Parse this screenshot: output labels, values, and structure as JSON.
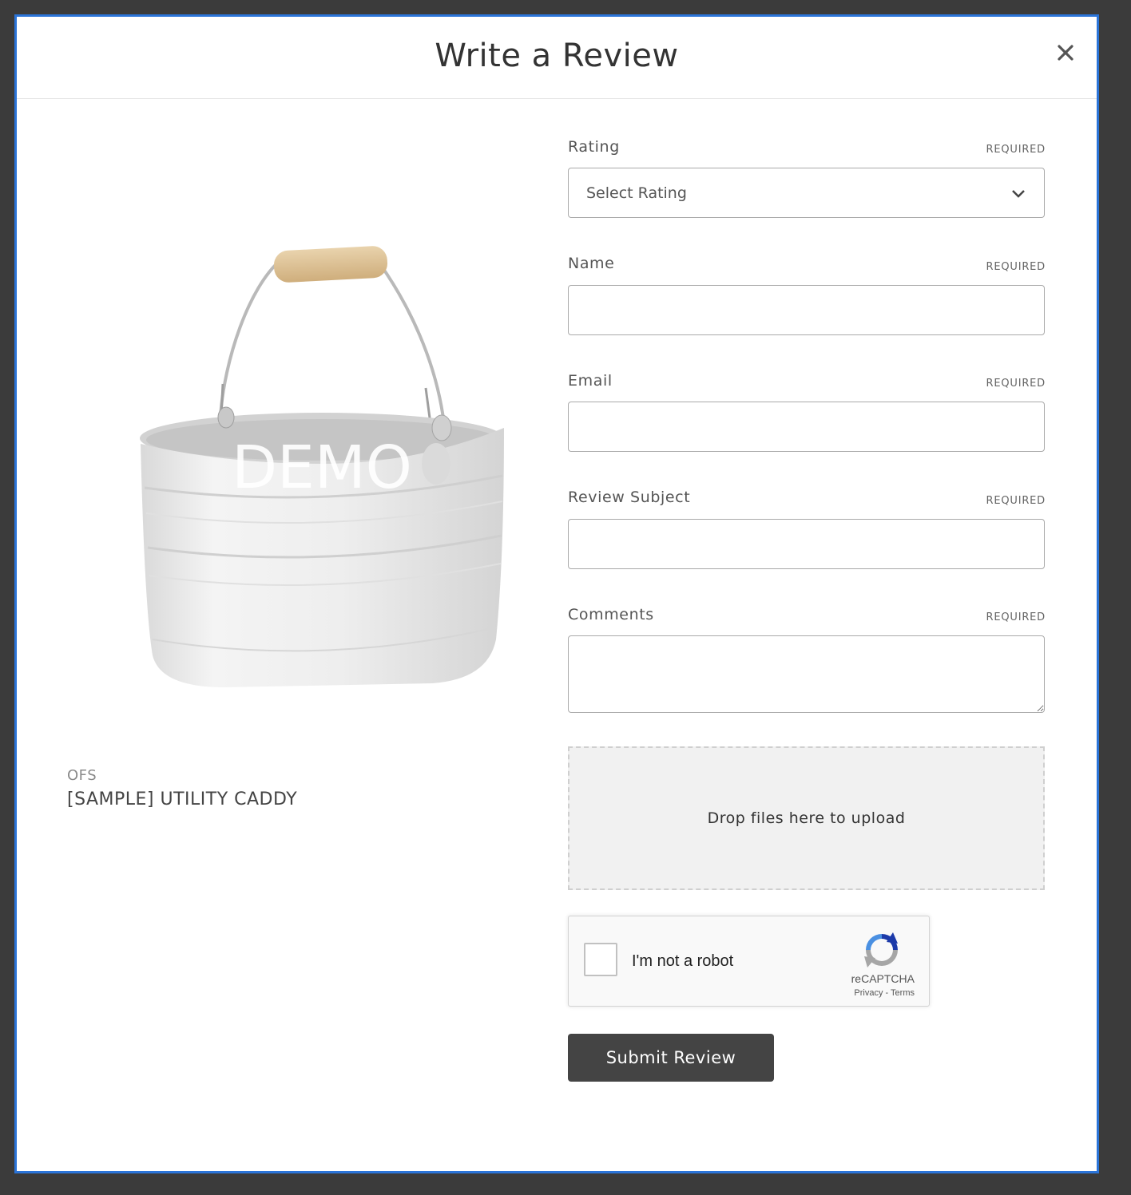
{
  "modal": {
    "title": "Write a Review",
    "close_label": "×"
  },
  "product": {
    "watermark": "DEMO",
    "brand": "OFS",
    "name": "[SAMPLE] UTILITY CADDY"
  },
  "form": {
    "required_text": "REQUIRED",
    "rating": {
      "label": "Rating",
      "selected": "Select Rating"
    },
    "name": {
      "label": "Name",
      "value": ""
    },
    "email": {
      "label": "Email",
      "value": ""
    },
    "subject": {
      "label": "Review Subject",
      "value": ""
    },
    "comments": {
      "label": "Comments",
      "value": ""
    },
    "dropzone_text": "Drop files here to upload",
    "captcha": {
      "label": "I'm not a robot",
      "brand": "reCAPTCHA",
      "privacy": "Privacy",
      "separator": " - ",
      "terms": "Terms"
    },
    "submit_label": "Submit Review"
  },
  "colors": {
    "modal_border": "#2b74d8",
    "submit_bg": "#444444",
    "backdrop": "#3b3b3b"
  }
}
